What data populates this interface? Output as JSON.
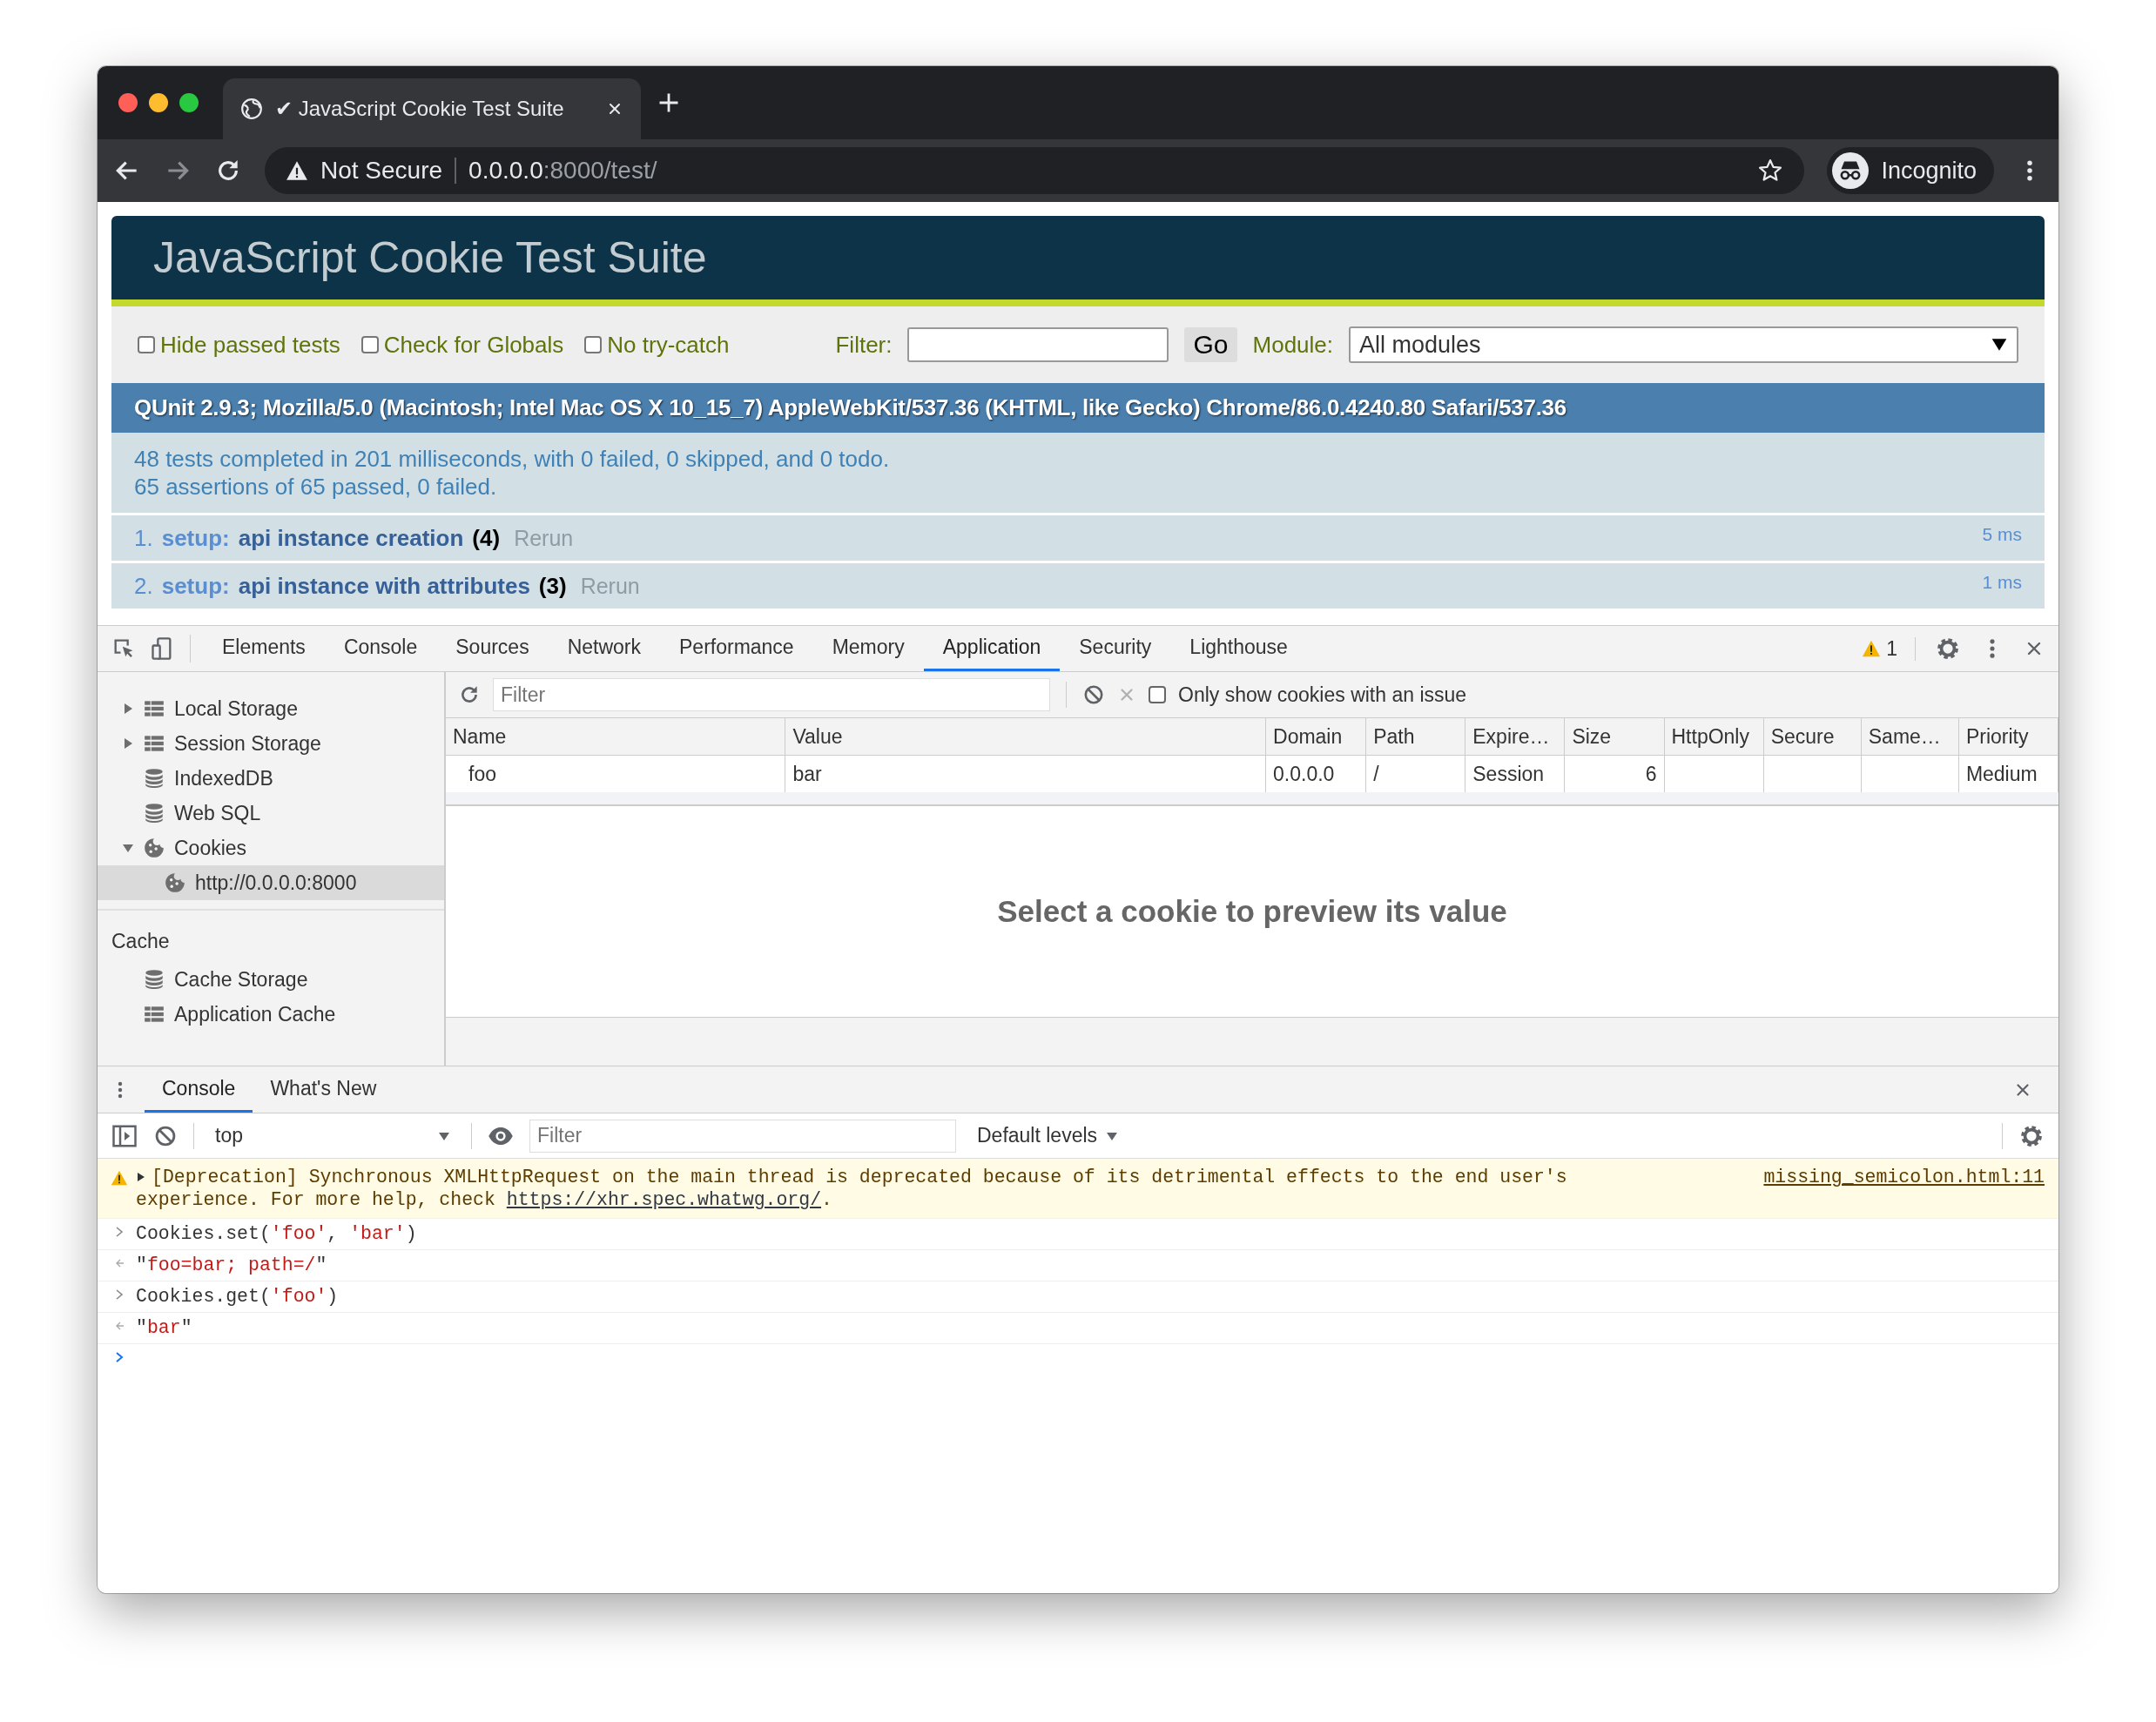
{
  "browser": {
    "tabs": [
      {
        "title": "✔ JavaScript Cookie Test Suite",
        "selected": true
      }
    ],
    "security": "Not Secure",
    "url_host": "0.0.0.0",
    "url_rest": ":8000/test/",
    "profile": "Incognito"
  },
  "page": {
    "title": "JavaScript Cookie Test Suite",
    "options": [
      {
        "label": "Hide passed tests",
        "checked": false
      },
      {
        "label": "Check for Globals",
        "checked": false
      },
      {
        "label": "No try-catch",
        "checked": false
      }
    ],
    "filter_label": "Filter:",
    "go": "Go",
    "module_label": "Module:",
    "module_value": "All modules",
    "user_agent": "QUnit 2.9.3; Mozilla/5.0 (Macintosh; Intel Mac OS X 10_15_7) AppleWebKit/537.36 (KHTML, like Gecko) Chrome/86.0.4240.80 Safari/537.36",
    "summary": [
      "48 tests completed in 201 milliseconds, with 0 failed, 0 skipped, and 0 todo.",
      "65 assertions of 65 passed, 0 failed."
    ],
    "tests": [
      {
        "number": "1.",
        "module": "setup:",
        "name": "api instance creation",
        "count": "(4)",
        "rerun": "Rerun",
        "time": "5 ms"
      },
      {
        "number": "2.",
        "module": "setup:",
        "name": "api instance with attributes",
        "count": "(3)",
        "rerun": "Rerun",
        "time": "1 ms"
      }
    ]
  },
  "devtools": {
    "tabs": [
      {
        "label": "Elements",
        "selected": false
      },
      {
        "label": "Console",
        "selected": false
      },
      {
        "label": "Sources",
        "selected": false
      },
      {
        "label": "Network",
        "selected": false
      },
      {
        "label": "Performance",
        "selected": false
      },
      {
        "label": "Memory",
        "selected": false
      },
      {
        "label": "Application",
        "selected": true
      },
      {
        "label": "Security",
        "selected": false
      },
      {
        "label": "Lighthouse",
        "selected": false
      }
    ],
    "warning_count": "1",
    "sidebar": [
      {
        "items": [
          {
            "label": "Local Storage",
            "kind": "table",
            "expanded": false,
            "selected": false
          },
          {
            "label": "Session Storage",
            "kind": "table",
            "expanded": false,
            "selected": false
          },
          {
            "label": "IndexedDB",
            "kind": "database",
            "selected": false
          },
          {
            "label": "Web SQL",
            "kind": "database",
            "selected": false
          },
          {
            "label": "Cookies",
            "kind": "cookie",
            "expanded": true,
            "selected": false,
            "children": [
              {
                "label": "http://0.0.0.0:8000",
                "kind": "cookie",
                "selected": true
              }
            ]
          }
        ]
      },
      {
        "title": "Cache",
        "items": [
          {
            "label": "Cache Storage",
            "kind": "database",
            "selected": false
          },
          {
            "label": "Application Cache",
            "kind": "table",
            "selected": false
          }
        ]
      }
    ],
    "cookies": {
      "filter_placeholder": "Filter",
      "issue_filter": {
        "label": "Only show cookies with an issue",
        "checked": false
      },
      "columns": [
        "Name",
        "Value",
        "Domain",
        "Path",
        "Expire…",
        "Size",
        "HttpOnly",
        "Secure",
        "Same…",
        "Priority"
      ],
      "rows": [
        {
          "cells": [
            "foo",
            "bar",
            "0.0.0.0",
            "/",
            "Session",
            "6",
            null,
            null,
            null,
            "Medium"
          ]
        }
      ],
      "preview_message": "Select a cookie to preview its value"
    }
  },
  "console": {
    "tabs": [
      {
        "label": "Console",
        "selected": true
      },
      {
        "label": "What's New",
        "selected": false
      }
    ],
    "context": "top",
    "filter_placeholder": "Filter",
    "levels": "Default levels",
    "messages": [
      {
        "kind": "warning",
        "text": "[Deprecation] Synchronous XMLHttpRequest on the main thread is deprecated because of its detrimental effects to the end user's experience. For more help, check ",
        "link": "https://xhr.spec.whatwg.org/",
        "text_end": ".",
        "source": "missing_semicolon.html:11"
      },
      {
        "kind": "input",
        "parts": [
          {
            "text": "Cookies.set(",
            "kind": "plain"
          },
          {
            "text": "'foo'",
            "kind": "string"
          },
          {
            "text": ", ",
            "kind": "plain"
          },
          {
            "text": "'bar'",
            "kind": "string"
          },
          {
            "text": ")",
            "kind": "plain"
          }
        ]
      },
      {
        "kind": "output",
        "parts": [
          {
            "text": "\"",
            "kind": "plain"
          },
          {
            "text": "foo=bar; path=/",
            "kind": "string"
          },
          {
            "text": "\"",
            "kind": "plain"
          }
        ]
      },
      {
        "kind": "input",
        "parts": [
          {
            "text": "Cookies.get(",
            "kind": "plain"
          },
          {
            "text": "'foo'",
            "kind": "string"
          },
          {
            "text": ")",
            "kind": "plain"
          }
        ]
      },
      {
        "kind": "output",
        "parts": [
          {
            "text": "\"",
            "kind": "plain"
          },
          {
            "text": "bar",
            "kind": "string"
          },
          {
            "text": "\"",
            "kind": "plain"
          }
        ]
      },
      {
        "kind": "prompt"
      }
    ]
  }
}
